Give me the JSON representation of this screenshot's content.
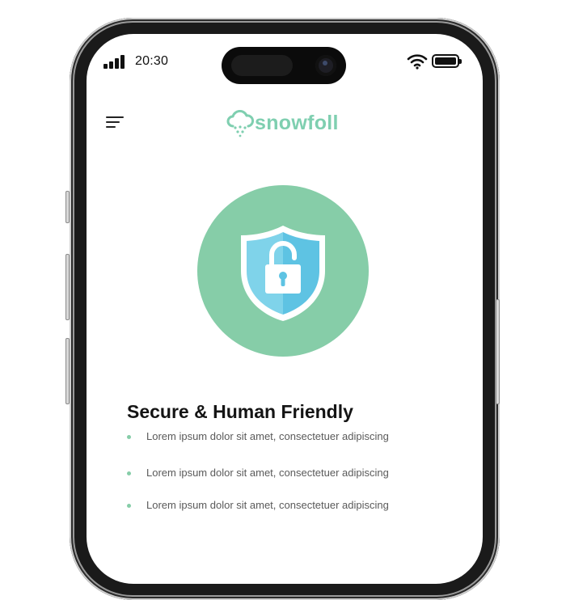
{
  "status_bar": {
    "time": "20:30"
  },
  "brand": {
    "name": "snowfoll",
    "color": "#7fcfb0"
  },
  "header": {
    "menu_icon": "hamburger-menu-icon"
  },
  "hero": {
    "icon": "shield-lock-icon",
    "circle_color": "#86cda8"
  },
  "content": {
    "heading": "Secure & Human Friendly",
    "bullets": [
      "Lorem ipsum dolor sit amet, consectetuer adipiscing",
      "Lorem ipsum dolor sit amet, consectetuer adipiscing",
      "Lorem ipsum dolor sit amet, consectetuer adipiscing"
    ]
  }
}
